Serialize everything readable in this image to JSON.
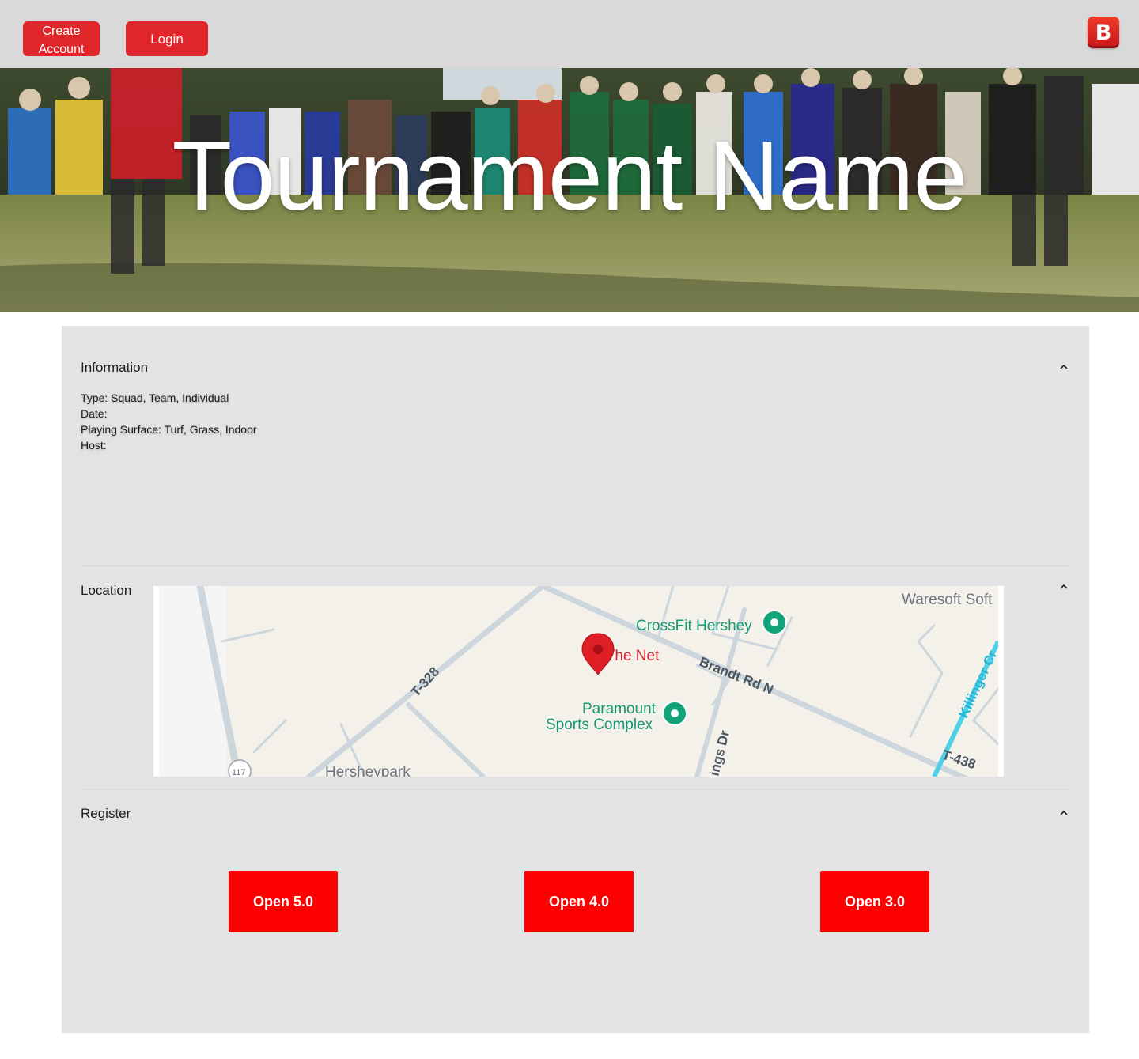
{
  "nav": {
    "create_account_label": "Create Account",
    "login_label": "Login",
    "logo_letter": "B"
  },
  "hero": {
    "title": "Tournament Name"
  },
  "information": {
    "title": "Information",
    "type": "Type: Squad, Team, Individual",
    "date": "Date:",
    "surface": "Playing Surface: Turf, Grass, Indoor",
    "host": "Host:"
  },
  "location": {
    "title": "Location",
    "map": {
      "labels": {
        "crossfit": "CrossFit Hershey",
        "in_the_net": "In The Net",
        "brandt": "Brandt Rd N",
        "t328": "T-328",
        "paramount_1": "Paramount",
        "paramount_2": "Sports Complex",
        "waresoft": "Waresoft Soft",
        "killinger": "Killinger Cr",
        "t438": "T-438",
        "hersheypark": "Hersheypark",
        "ings": "ings Dr",
        "route": "117"
      },
      "pin_color": "#e01e26",
      "poi_color": "#13a37a"
    }
  },
  "register": {
    "title": "Register",
    "buttons": [
      "Open 5.0",
      "Open 4.0",
      "Open 3.0"
    ],
    "button_color": "#ff0000"
  }
}
